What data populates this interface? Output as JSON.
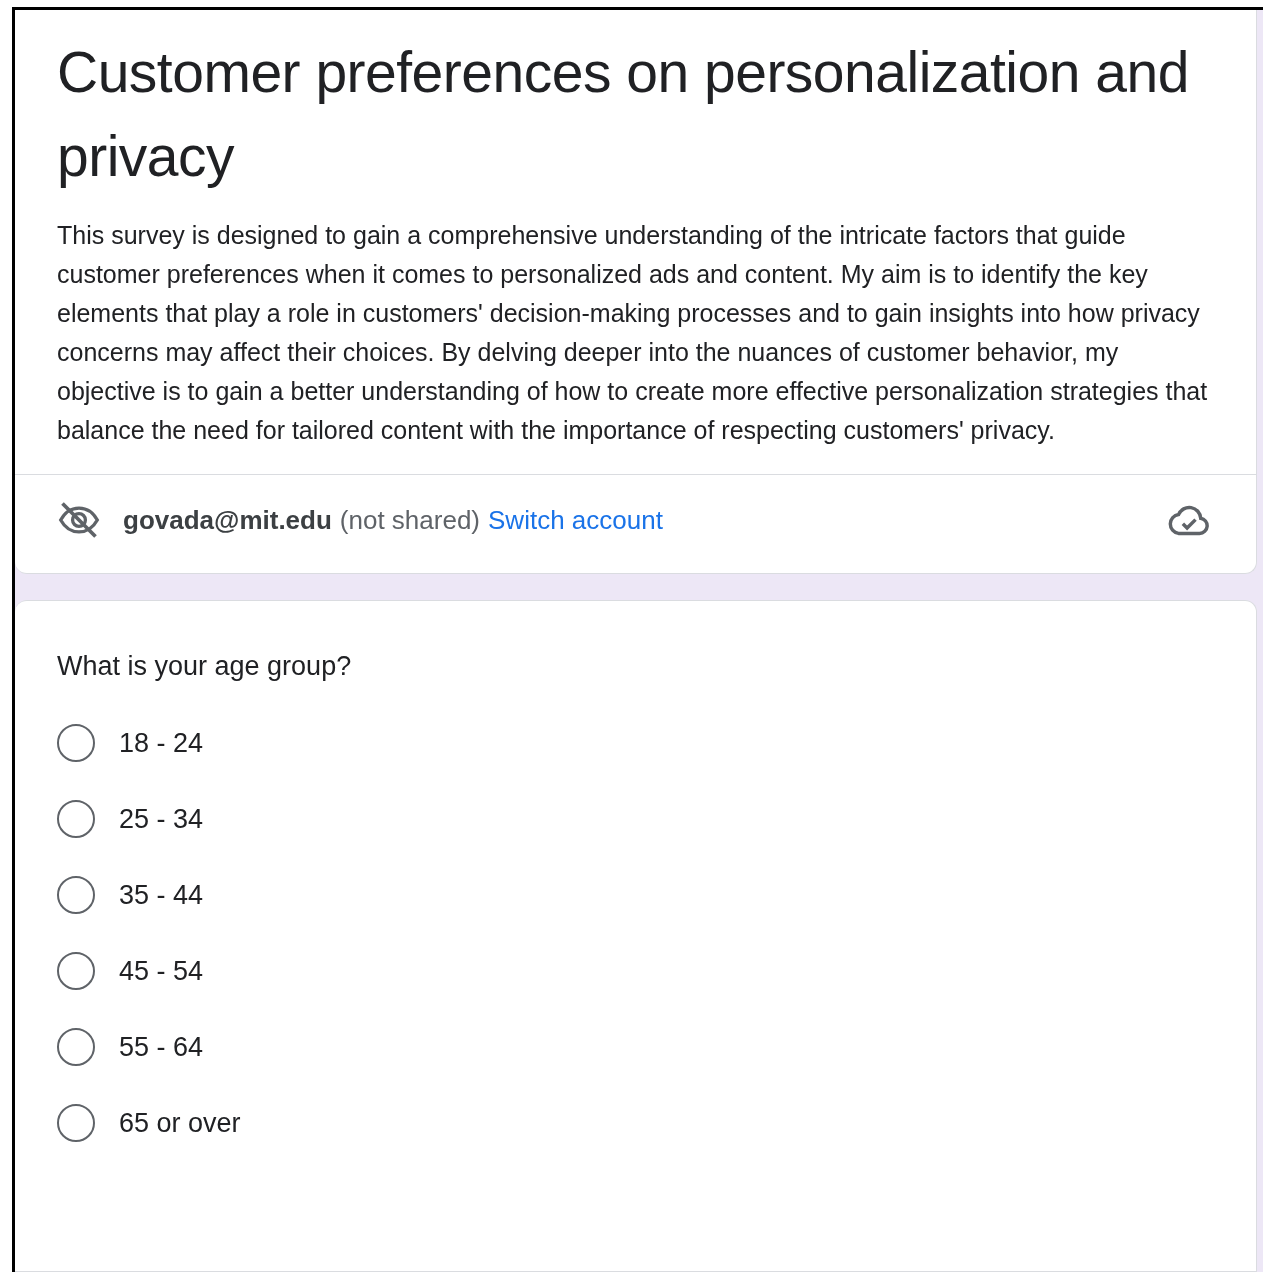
{
  "form": {
    "title": "Customer preferences on personalization and privacy",
    "description": "This survey is designed to gain a comprehensive understanding of the intricate factors that guide customer preferences when it comes to personalized ads and content. My aim is to identify the key elements that play a role in customers' decision-making processes and to gain insights into how privacy concerns may affect their choices. By delving deeper into the nuances of customer behavior, my objective is to gain a better understanding of how to create more effective personalization strategies that balance the need for tailored content with the importance of respecting customers' privacy."
  },
  "account": {
    "email": "govada@mit.edu",
    "note": "(not shared)",
    "switch_link": "Switch account"
  },
  "question": {
    "title": "What is your age group?",
    "options": [
      {
        "label": "18 - 24",
        "selected": false
      },
      {
        "label": "25 - 34",
        "selected": false
      },
      {
        "label": "35 - 44",
        "selected": false
      },
      {
        "label": "45 - 54",
        "selected": false
      },
      {
        "label": "55 - 64",
        "selected": false
      },
      {
        "label": "65 or over",
        "selected": false
      }
    ]
  }
}
